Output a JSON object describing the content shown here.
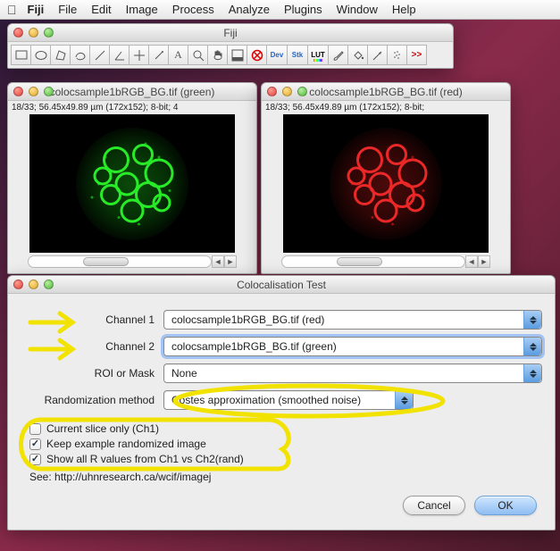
{
  "menubar": {
    "apple": "",
    "app": "Fiji",
    "items": [
      "File",
      "Edit",
      "Image",
      "Process",
      "Analyze",
      "Plugins",
      "Window",
      "Help"
    ]
  },
  "fiji_main": {
    "title": "Fiji",
    "more_symbol": ">>"
  },
  "image_green": {
    "title": "colocsample1bRGB_BG.tif (green)",
    "meta": "18/33; 56.45x49.89 µm (172x152); 8-bit; 4"
  },
  "image_red": {
    "title": "colocsample1bRGB_BG.tif (red)",
    "meta": "18/33; 56.45x49.89 µm (172x152); 8-bit;"
  },
  "dialog": {
    "title": "Colocalisation Test",
    "rows": {
      "channel1_label": "Channel 1",
      "channel1_value": "colocsample1bRGB_BG.tif (red)",
      "channel2_label": "Channel 2",
      "channel2_value": "colocsample1bRGB_BG.tif (green)",
      "roi_label": "ROI or Mask",
      "roi_value": "None",
      "rand_label": "Randomization method",
      "rand_value": "Costes approximation (smoothed noise)"
    },
    "checks": {
      "c1_label": "Current slice only (Ch1)",
      "c1_checked": false,
      "c2_label": "Keep example randomized image",
      "c2_checked": true,
      "c3_label": "Show all R values from Ch1 vs  Ch2(rand)",
      "c3_checked": true
    },
    "see_label": "See: http://uhnresearch.ca/wcif/imagej",
    "cancel": "Cancel",
    "ok": "OK"
  },
  "colors": {
    "annotation": "#f2e200"
  }
}
